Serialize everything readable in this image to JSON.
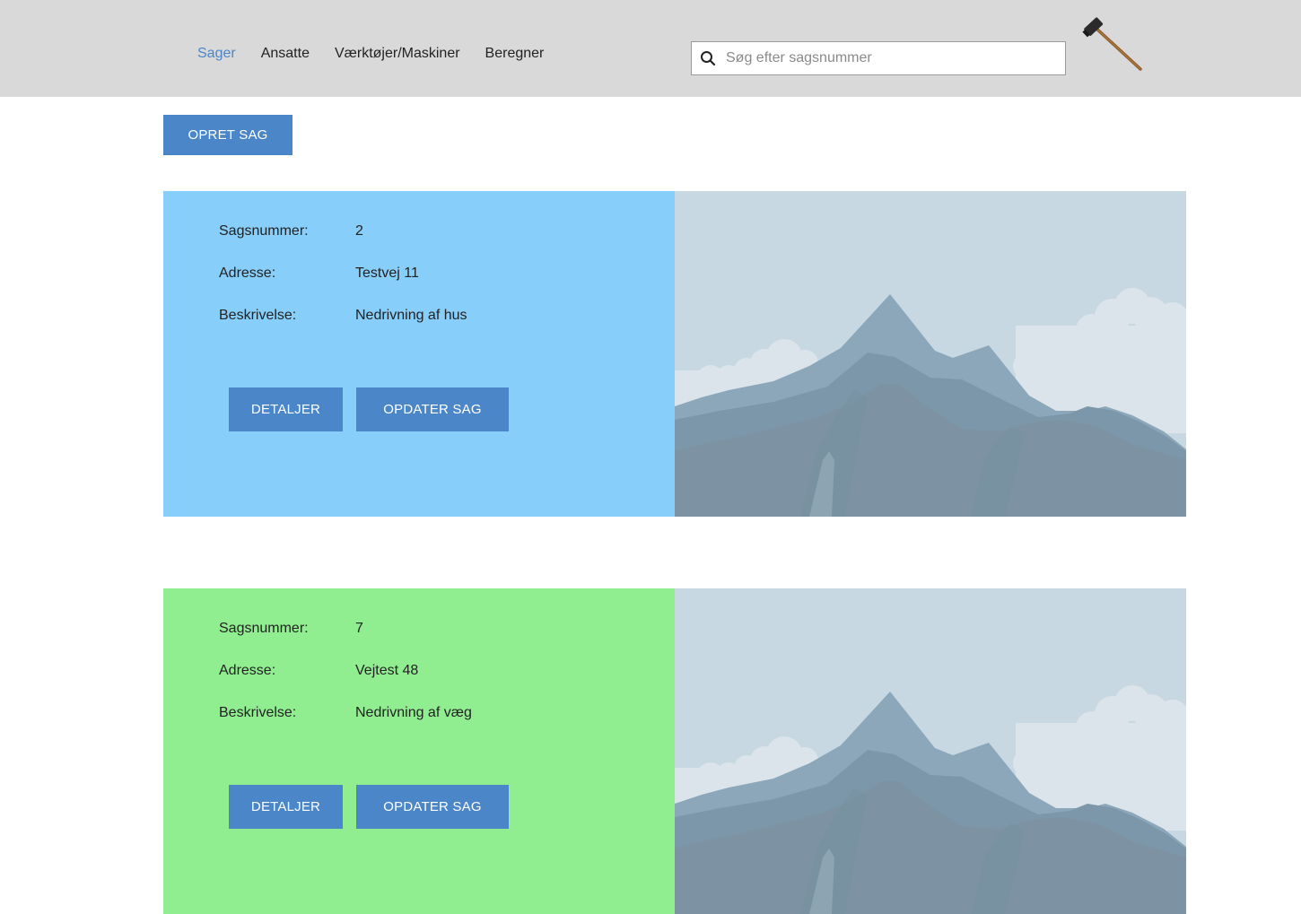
{
  "header": {
    "nav": [
      {
        "label": "Sager",
        "active": true
      },
      {
        "label": "Ansatte",
        "active": false
      },
      {
        "label": "Værktøjer/Maskiner",
        "active": false
      },
      {
        "label": "Beregner",
        "active": false
      }
    ],
    "search": {
      "placeholder": "Søg efter sagsnummer",
      "value": "",
      "icon": "search-icon"
    },
    "logo_icon": "hammer-icon"
  },
  "main": {
    "create_button": "OPRET SAG",
    "cases": [
      {
        "labels": {
          "number": "Sagsnummer:",
          "address": "Adresse:",
          "description": "Beskrivelse:"
        },
        "number": "2",
        "address": "Testvej 11",
        "description": "Nedrivning af hus",
        "details_button": "DETALJER",
        "update_button": "OPDATER SAG",
        "background_color": "#87cefa",
        "image_icon": "mountain-placeholder-image"
      },
      {
        "labels": {
          "number": "Sagsnummer:",
          "address": "Adresse:",
          "description": "Beskrivelse:"
        },
        "number": "7",
        "address": "Vejtest 48",
        "description": "Nedrivning af væg",
        "details_button": "DETALJER",
        "update_button": "OPDATER SAG",
        "background_color": "#90ee90",
        "image_icon": "mountain-placeholder-image"
      }
    ]
  },
  "colors": {
    "header_bg": "#d9d9d9",
    "accent": "#4a86c8",
    "active_nav": "#4a86c8"
  }
}
